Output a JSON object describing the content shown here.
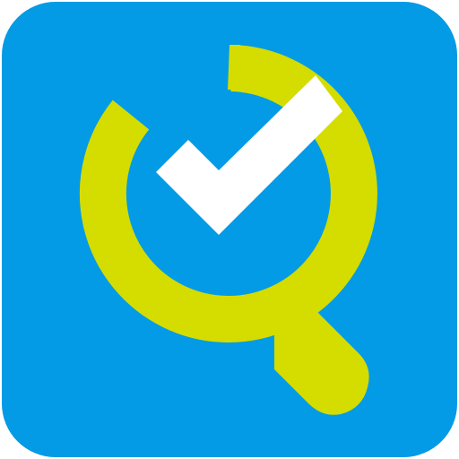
{
  "icon": {
    "semantic_name": "search-check-icon",
    "description_role": "app-icon",
    "colors": {
      "background": "#039be5",
      "magnifier": "#d4dc00",
      "checkmark": "#ffffff"
    }
  }
}
